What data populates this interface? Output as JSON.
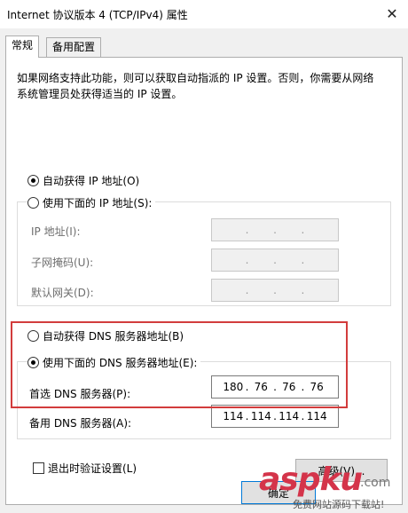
{
  "window": {
    "title": "Internet 协议版本 4 (TCP/IPv4) 属性",
    "close_glyph": "✕"
  },
  "tabs": [
    {
      "label": "常规"
    },
    {
      "label": "备用配置"
    }
  ],
  "description": "如果网络支持此功能，则可以获取自动指派的 IP 设置。否则，你需要从网络系统管理员处获得适当的 IP 设置。",
  "ip_section": {
    "auto_label": "自动获得 IP 地址(O)",
    "auto_checked": true,
    "manual_label": "使用下面的 IP 地址(S):",
    "manual_checked": false,
    "fields": [
      {
        "label": "IP 地址(I):",
        "octets": [
          "",
          "",
          "",
          ""
        ]
      },
      {
        "label": "子网掩码(U):",
        "octets": [
          "",
          "",
          "",
          ""
        ]
      },
      {
        "label": "默认网关(D):",
        "octets": [
          "",
          "",
          "",
          ""
        ]
      }
    ]
  },
  "dns_section": {
    "auto_label": "自动获得 DNS 服务器地址(B)",
    "auto_checked": false,
    "manual_label": "使用下面的 DNS 服务器地址(E):",
    "manual_checked": true,
    "fields": [
      {
        "label": "首选 DNS 服务器(P):",
        "octets": [
          "180",
          "76",
          "76",
          "76"
        ]
      },
      {
        "label": "备用 DNS 服务器(A):",
        "octets": [
          "114",
          "114",
          "114",
          "114"
        ]
      }
    ]
  },
  "validate_label": "退出时验证设置(L)",
  "validate_checked": false,
  "advanced_label": "高级(V)...",
  "ok_label": "确定",
  "watermark": {
    "brand": "aspku",
    "suffix": ".com",
    "tagline": "免费网站源码下载站!"
  },
  "colors": {
    "highlight": "#d23c3c",
    "panel_bg": "#f0f0f0"
  }
}
